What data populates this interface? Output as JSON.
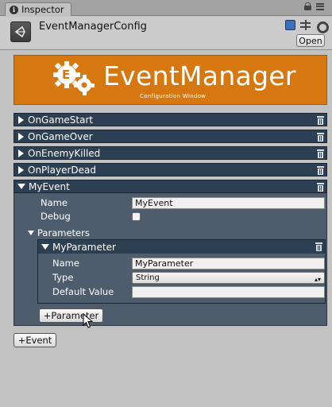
{
  "tab": {
    "label": "Inspector"
  },
  "header": {
    "title": "EventManagerConfig",
    "open_label": "Open"
  },
  "banner": {
    "title": "EventManager",
    "subtitle": "Configuration Window"
  },
  "events": {
    "collapsed": [
      "OnGameStart",
      "OnGameOver",
      "OnEnemyKilled",
      "OnPlayerDead"
    ],
    "expanded": {
      "name": "MyEvent",
      "name_label": "Name",
      "name_value": "MyEvent",
      "debug_label": "Debug",
      "debug_checked": false,
      "parameters_label": "Parameters",
      "parameter": {
        "name": "MyParameter",
        "name_label": "Name",
        "name_value": "MyParameter",
        "type_label": "Type",
        "type_value": "String",
        "default_label": "Default Value",
        "default_value": ""
      },
      "add_parameter_label": "+Parameter"
    }
  },
  "add_event_label": "+Event",
  "colors": {
    "banner": "#d6770f",
    "row_header": "#2d3f52",
    "panel": "#4e5d6d",
    "background": "#c2c2c2"
  }
}
